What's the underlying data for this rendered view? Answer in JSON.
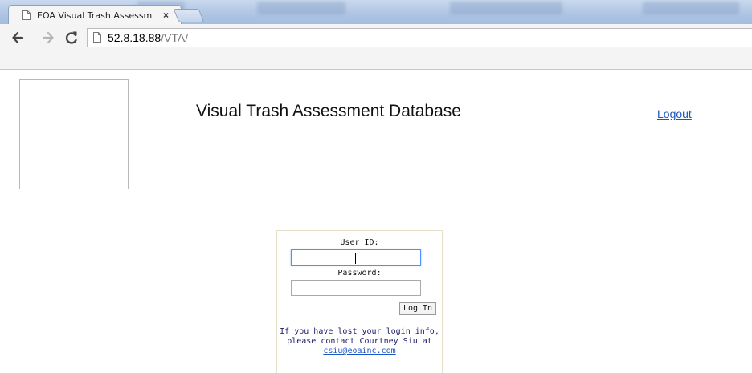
{
  "browser": {
    "tab": {
      "title": "EOA Visual Trash Assessm",
      "close_label": "×"
    },
    "nav": {
      "back_icon": "back-arrow-icon",
      "forward_icon": "forward-arrow-icon",
      "reload_icon": "reload-icon"
    },
    "address_bar": {
      "host": "52.8.18.88",
      "path": "/VTA/"
    }
  },
  "header": {
    "title": "Visual Trash Assessment Database",
    "logout_label": "Logout"
  },
  "login": {
    "user_id_label": "User ID:",
    "user_id_value": "",
    "password_label": "Password:",
    "password_value": "",
    "submit_label": "Log In",
    "help_line_1": "If you have lost your login info,",
    "help_line_2": "please contact Courtney Siu at",
    "help_email": "csiu@eoainc.com"
  },
  "colors": {
    "link": "#1a55c4",
    "help_text": "#1b1b6b",
    "focus_border": "#4d90fe",
    "login_box_border": "#e5dfc8"
  }
}
